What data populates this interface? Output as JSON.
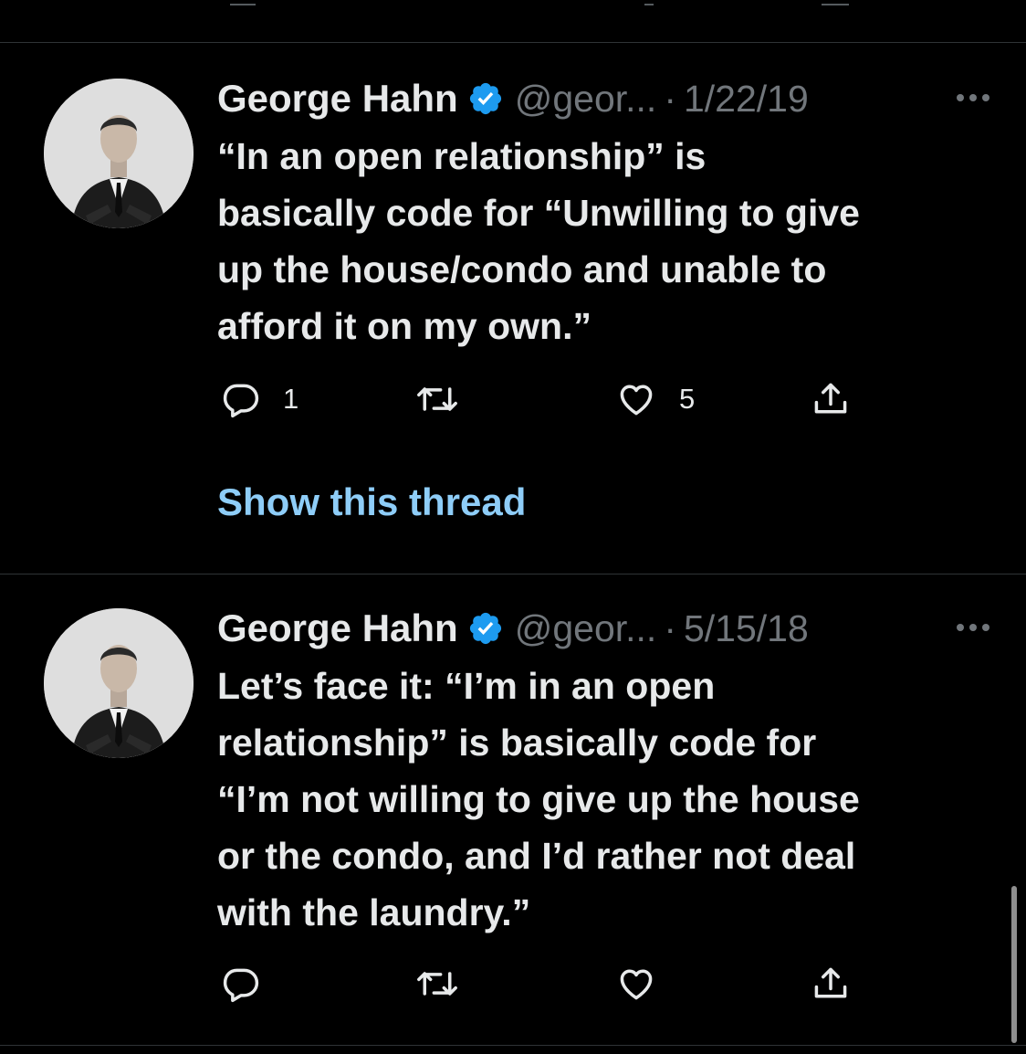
{
  "colors": {
    "background": "#000000",
    "text_primary": "#e7e9ea",
    "text_secondary": "#71767b",
    "link": "#8ecdf8",
    "verified": "#1d9bf0",
    "divider": "#2f3336"
  },
  "tweets": [
    {
      "name": "George Hahn",
      "handle": "@geor...",
      "separator": "·",
      "date": "1/22/19",
      "text": "“In an open relationship” is\nbasically code for “Unwilling to give\nup the house/condo and unable to\nafford it on my own.”",
      "reply_count": "1",
      "retweet_count": "",
      "like_count": "5",
      "icons": [
        "verified-badge-icon",
        "more-icon",
        "reply-icon",
        "retweet-icon",
        "like-icon",
        "share-icon"
      ]
    },
    {
      "name": "George Hahn",
      "handle": "@geor...",
      "separator": "·",
      "date": "5/15/18",
      "text": "Let’s face it: “I’m in an open\nrelationship” is basically code for\n“I’m not willing to give up the house\nor the condo, and I’d rather not deal\nwith the laundry.”",
      "reply_count": "",
      "retweet_count": "",
      "like_count": "",
      "icons": [
        "verified-badge-icon",
        "more-icon",
        "reply-icon",
        "retweet-icon",
        "like-icon",
        "share-icon"
      ]
    }
  ],
  "show_thread": {
    "label": "Show this thread"
  }
}
